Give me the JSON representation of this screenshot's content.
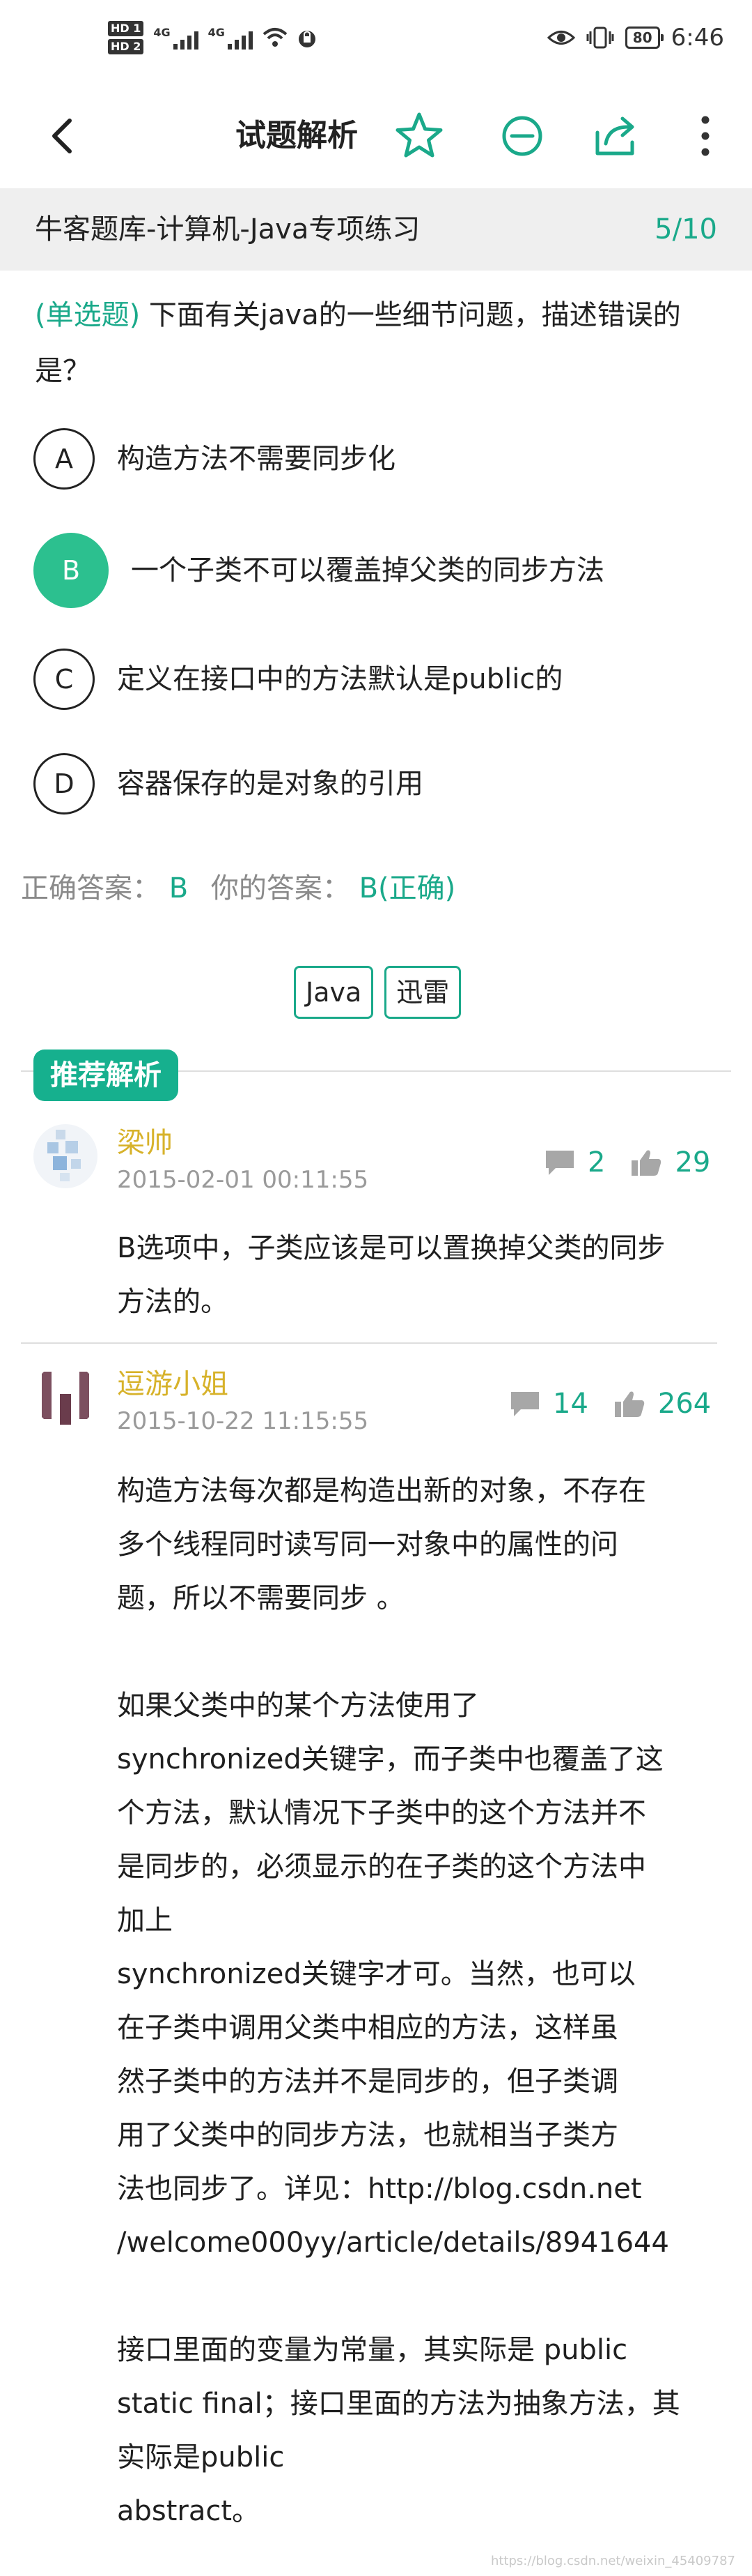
{
  "status_bar": {
    "hd1": "HD 1",
    "hd2": "HD 2",
    "net1": "4G",
    "net2": "4G",
    "battery": "80",
    "time": "6:46"
  },
  "app_bar": {
    "title": "试题解析"
  },
  "banner": {
    "title": "牛客题库-计算机-Java专项练习",
    "progress": "5/10"
  },
  "question": {
    "type": "(单选题)",
    "text": " 下面有关java的一些细节问题，描述错误的是？"
  },
  "options": [
    {
      "letter": "A",
      "text": "构造方法不需要同步化"
    },
    {
      "letter": "B",
      "text": "一个子类不可以覆盖掉父类的同步方法"
    },
    {
      "letter": "C",
      "text": "定义在接口中的方法默认是public的"
    },
    {
      "letter": "D",
      "text": "容器保存的是对象的引用"
    }
  ],
  "answer": {
    "correct_label": "正确答案：",
    "correct_value": "B",
    "yours_label": "你的答案：",
    "yours_value": "B(正确)"
  },
  "tags": [
    "Java",
    "迅雷"
  ],
  "section_title": "推荐解析",
  "comments": [
    {
      "name": "梁帅",
      "date": "2015-02-01 00:11:55",
      "reply_count": "2",
      "like_count": "29",
      "body": [
        "B选项中，子类应该是可以置换掉父类的同步",
        "方法的。"
      ]
    },
    {
      "name": "逗游小姐",
      "date": "2015-10-22 11:15:55",
      "reply_count": "14",
      "like_count": "264",
      "body": [
        "构造方法每次都是构造出新的对象，不存在",
        "多个线程同时读写同一对象中的属性的问",
        "题，所以不需要同步 。",
        "",
        "如果父类中的某个方法使用了",
        "synchronized关键字，而子类中也覆盖了这",
        "个方法，默认情况下子类中的这个方法并不",
        "是同步的，必须显示的在子类的这个方法中",
        "加上",
        "synchronized关键字才可。当然，也可以",
        "在子类中调用父类中相应的方法，这样虽",
        "然子类中的方法并不是同步的，但子类调",
        "用了父类中的同步方法，也就相当子类方",
        "法也同步了。详见：http://blog.csdn.net",
        "/welcome000yy/article/details/8941644",
        "",
        "接口里面的变量为常量，其实际是 public",
        "static final；接口里面的方法为抽象方法，其",
        "实际是public",
        "abstract。"
      ]
    }
  ],
  "watermark": "https://blog.csdn.net/weixin_45409787",
  "colors": {
    "accent": "#1aa98a",
    "selected": "#2cc08f",
    "username": "#d7b22a"
  }
}
